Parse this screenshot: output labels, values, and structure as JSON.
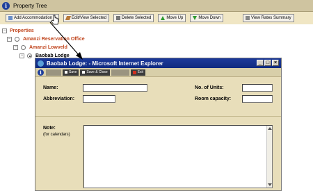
{
  "header": {
    "title": "Property Tree"
  },
  "toolbar": {
    "add": "Add Accommodation",
    "edit": "Edit/View Selected",
    "delete": "Delete Selected",
    "move_up": "Move Up",
    "move_down": "Move Down",
    "rates": "View Rates Summary"
  },
  "tree": {
    "root": "Properties",
    "level1": "Amanzi Reservation Office",
    "level2": "Amanzi Lowveld",
    "level3": "Baobab Lodge"
  },
  "popup": {
    "title": "Baobab Lodge: - Microsoft Internet Explorer",
    "toolbar": {
      "save": "Save",
      "save_close": "Save & Close",
      "exit": "Exit"
    },
    "form": {
      "name_label": "Name:",
      "abbr_label": "Abbreviation:",
      "units_label": "No. of Units:",
      "capacity_label": "Room capacity:",
      "note_label": "Note:",
      "note_sub": "(for calendars)",
      "name_value": "",
      "abbr_value": "",
      "units_value": "",
      "capacity_value": "",
      "note_value": ""
    }
  },
  "colors": {
    "topbar": "#cfc4a0",
    "toolbar": "#f0e6c4",
    "popup_bg": "#e8deba",
    "title_blue": "#0f2a80",
    "tree_accent": "#c0441c"
  }
}
